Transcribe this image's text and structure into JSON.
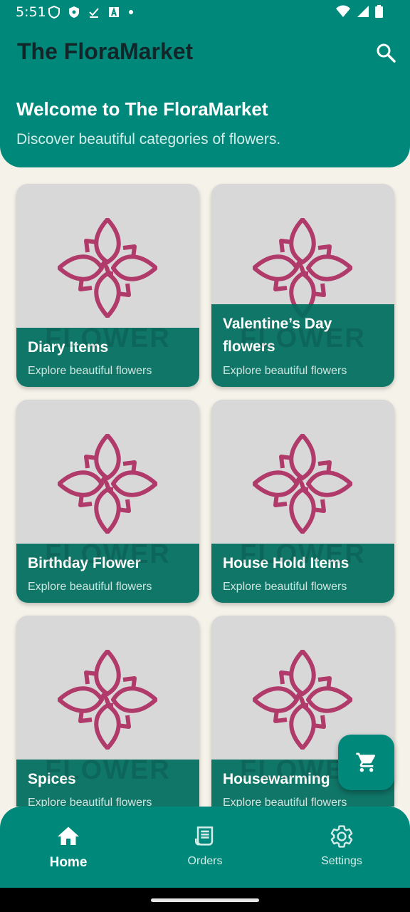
{
  "status_bar": {
    "time": "5:51"
  },
  "app_bar": {
    "title": "The FloraMarket"
  },
  "welcome": {
    "title": "Welcome to The FloraMarket",
    "subtitle": "Discover beautiful categories of flowers."
  },
  "categories": [
    {
      "title": "Diary Items",
      "subtitle": "Explore beautiful flowers",
      "watermark": "FLOWER"
    },
    {
      "title": "Valentine’s Day flowers",
      "subtitle": "Explore beautiful flowers",
      "watermark": "FLOWER"
    },
    {
      "title": "Birthday Flower",
      "subtitle": "Explore beautiful flowers",
      "watermark": "FLOWER"
    },
    {
      "title": "House Hold Items",
      "subtitle": "Explore beautiful flowers",
      "watermark": "FLOWER"
    },
    {
      "title": "Spices",
      "subtitle": "Explore beautiful flowers",
      "watermark": "FLOWER"
    },
    {
      "title": "Housewarming",
      "subtitle": "Explore beautiful flowers",
      "watermark": "FLOWER"
    }
  ],
  "bottom_nav": {
    "items": [
      {
        "label": "Home",
        "icon": "home-icon",
        "active": true
      },
      {
        "label": "Orders",
        "icon": "receipt-icon",
        "active": false
      },
      {
        "label": "Settings",
        "icon": "gear-icon",
        "active": false
      }
    ]
  },
  "colors": {
    "primary": "#00897b",
    "card_overlay": "#006e5f",
    "card_bg": "#d8d8d8",
    "logo": "#b03a6a",
    "page_bg": "#f5f3e9"
  }
}
